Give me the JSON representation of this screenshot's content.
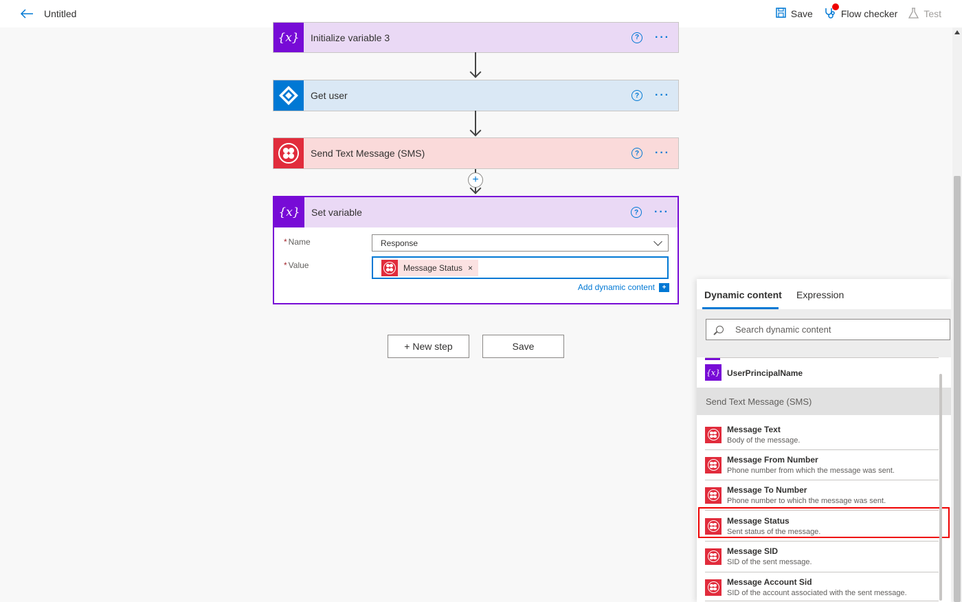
{
  "header": {
    "title": "Untitled",
    "save_label": "Save",
    "flow_checker_label": "Flow checker",
    "test_label": "Test"
  },
  "steps": {
    "init_variable": {
      "title": "Initialize variable 3"
    },
    "get_user": {
      "title": "Get user"
    },
    "send_sms": {
      "title": "Send Text Message (SMS)"
    },
    "set_variable": {
      "title": "Set variable",
      "name_label": "Name",
      "name_value": "Response",
      "value_label": "Value",
      "value_token": "Message Status",
      "add_dynamic_label": "Add dynamic content"
    }
  },
  "actions": {
    "new_step_label": "+ New step",
    "save_label": "Save"
  },
  "dynamic_panel": {
    "tab_dynamic": "Dynamic content",
    "tab_expression": "Expression",
    "search_placeholder": "Search dynamic content",
    "variable_item": "UserPrincipalName",
    "group_title": "Send Text Message (SMS)",
    "items": [
      {
        "title": "Message Text",
        "desc": "Body of the message."
      },
      {
        "title": "Message From Number",
        "desc": "Phone number from which the message was sent."
      },
      {
        "title": "Message To Number",
        "desc": "Phone number to which the message was sent."
      },
      {
        "title": "Message Status",
        "desc": "Sent status of the message."
      },
      {
        "title": "Message SID",
        "desc": "SID of the sent message."
      },
      {
        "title": "Message Account Sid",
        "desc": "SID of the account associated with the sent message."
      }
    ]
  },
  "colors": {
    "variable_purple": "#770bd6",
    "azure_ad_blue": "#0078d4",
    "twilio_red": "#e12c3c",
    "highlight_red": "#ee0000"
  }
}
